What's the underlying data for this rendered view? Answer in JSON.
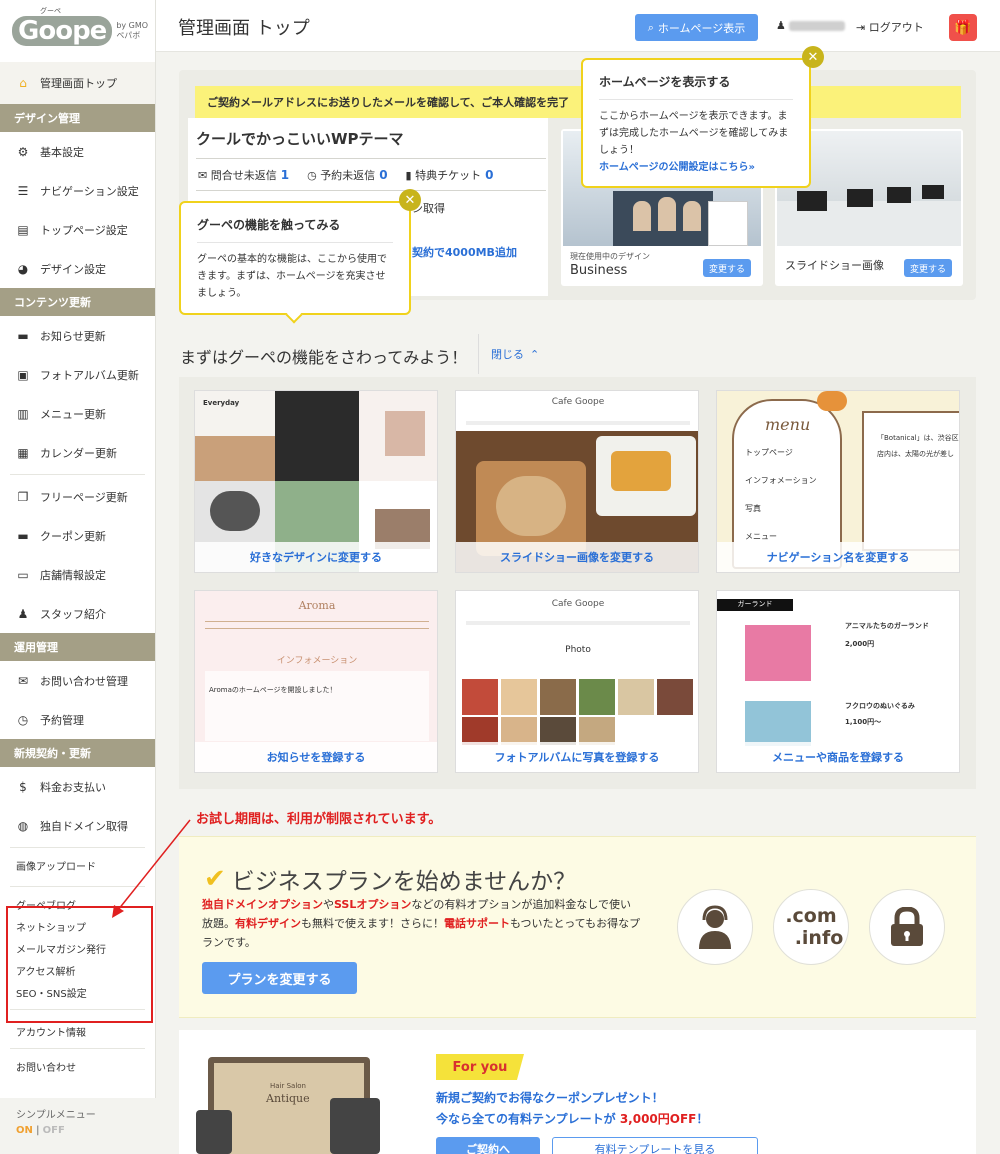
{
  "sidebar": {
    "logo": "Goope",
    "logo_sub": "by GMOペパボ",
    "logo_top": "グーペ",
    "home": "管理画面トップ",
    "sections": {
      "design": "デザイン管理",
      "content": "コンテンツ更新",
      "operation": "運用管理",
      "contract": "新規契約・更新"
    },
    "items": {
      "basic": "基本設定",
      "navigation": "ナビゲーション設定",
      "toppage": "トップページ設定",
      "design": "デザイン設定",
      "news": "お知らせ更新",
      "photo": "フォトアルバム更新",
      "menu": "メニュー更新",
      "calendar": "カレンダー更新",
      "free": "フリーページ更新",
      "coupon": "クーポン更新",
      "shop": "店舗情報設定",
      "staff": "スタッフ紹介",
      "inquiry": "お問い合わせ管理",
      "reserve": "予約管理",
      "payment": "料金お支払い",
      "domain": "独自ドメイン取得"
    },
    "small": {
      "image_upload": "画像アップロード",
      "blog": "グーペブログ",
      "netshop": "ネットショップ",
      "magazine": "メールマガジン発行",
      "access": "アクセス解析",
      "seo": "SEO・SNS設定",
      "account": "アカウント情報",
      "contact": "お問い合わせ"
    },
    "simple_menu": "シンプルメニュー",
    "on": "ON",
    "sep": "|",
    "off": "OFF"
  },
  "header": {
    "title": "管理画面 トップ",
    "hp_button": "ホームページ表示",
    "logout": "ログアウト"
  },
  "top": {
    "notice": "ご契約メールアドレスにお送りしたメールを確認して、ご本人確認を完了",
    "theme_name": "クールでかっこいいWPテーマ",
    "stat1_label": "問合せ未返信",
    "stat1_value": "1",
    "stat2_label": "予約未返信",
    "stat2_value": "0",
    "stat3_label": "特典チケット",
    "stat3_value": "0",
    "partial1": "ン取得",
    "partial2": "契約で4000MB追加",
    "current_design_small": "現在使用中のデザイン",
    "current_design": "Business",
    "change": "変更する",
    "slideshow_label": "スライドショー画像",
    "change2": "変更する"
  },
  "tooltip_hp": {
    "title": "ホームページを表示する",
    "body": "ここからホームページを表示できます。まずは完成したホームページを確認してみましょう！",
    "link": "ホームページの公開設定はこちら»"
  },
  "tooltip_goope": {
    "title": "グーペの機能を触ってみる",
    "body": "グーペの基本的な機能は、ここから使用できます。まずは、ホームページを充実させましょう。"
  },
  "features": {
    "heading": "まずはグーペの機能をさわってみよう！",
    "close": "閉じる",
    "cards": [
      "好きなデザインに変更する",
      "スライドショー画像を変更する",
      "ナビゲーション名を変更する",
      "お知らせを登録する",
      "フォトアルバムに写真を登録する",
      "メニューや商品を登録する"
    ],
    "thumb_texts": {
      "everyday": "Everyday",
      "cafe": "Cafe Goope",
      "menu": "menu",
      "nav_items": [
        "トップページ",
        "インフォメーション",
        "写真",
        "メニュー"
      ],
      "botanical1": "「Botanical」は、渋谷区",
      "botanical2": "店内は、太陽の光が差し",
      "aroma": "Aroma",
      "information": "インフォメーション",
      "aroma_news": "Aromaのホームページを開設しました！",
      "photo": "Photo",
      "garland": "ガーランド",
      "garland_title": "アニマルたちのガーランド",
      "garland_price": "2,000円",
      "owl": "フクロウのぬいぐるみ",
      "owl_price": "1,100円〜"
    }
  },
  "annotation": "お試し期間は、利用が制限されています。",
  "business": {
    "title": "ビジネスプランを始めませんか？",
    "check": "✔",
    "t1": "独自ドメインオプション",
    "t2": "や",
    "t3": "SSLオプション",
    "t4": "などの有料オプションが追加料金なしで使い放題。",
    "t5": "有料デザイン",
    "t6": "も無料で使えます！さらに！",
    "t7": "電話サポート",
    "t8": "もついたとってもお得なプランです。",
    "button": "プランを変更する",
    "dot_com": ".com",
    "dot_info": ".info"
  },
  "foryou": {
    "tag": "For you",
    "line1": "新規ご契約でお得なクーポンプレゼント！",
    "line2a": "今なら全ての有料テンプレートが ",
    "line2b": "3,000円OFF",
    "line2c": "！",
    "btn1": "ご契約へ",
    "btn2": "有料テンプレートを見る",
    "device_text1": "Hair Salon",
    "device_text2": "Antique"
  }
}
